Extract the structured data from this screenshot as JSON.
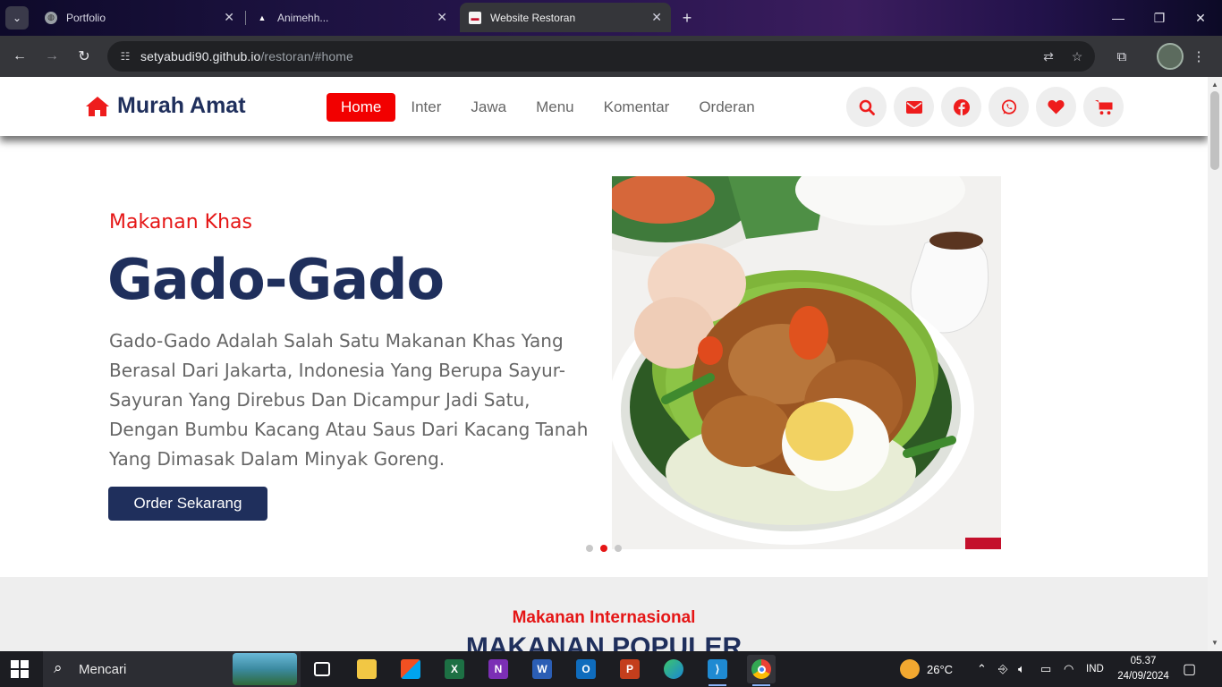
{
  "browser": {
    "tabs": [
      {
        "title": "Portfolio",
        "icon": "globe-icon",
        "active": false
      },
      {
        "title": "Animehh...",
        "icon": "triangle-icon",
        "active": false
      },
      {
        "title": "Website Restoran",
        "icon": "restaurant-favicon",
        "active": true
      }
    ],
    "url_host": "setyabudi90.github.io",
    "url_path": "/restoran/#home"
  },
  "site": {
    "brand": "Murah Amat",
    "nav": [
      {
        "label": "Home",
        "active": true
      },
      {
        "label": "Inter",
        "active": false
      },
      {
        "label": "Jawa",
        "active": false
      },
      {
        "label": "Menu",
        "active": false
      },
      {
        "label": "Komentar",
        "active": false
      },
      {
        "label": "Orderan",
        "active": false
      }
    ],
    "header_icons": [
      "search-icon",
      "envelope-icon",
      "facebook-icon",
      "whatsapp-icon",
      "heart-icon",
      "cart-icon"
    ],
    "accent": "#ee1c1c",
    "brand_color": "#1f2f5c"
  },
  "hero": {
    "subtitle": "Makanan Khas",
    "title": "Gado-Gado",
    "description": "Gado-Gado Adalah Salah Satu Makanan Khas Yang Berasal Dari Jakarta, Indonesia Yang Berupa Sayur-Sayuran Yang Direbus Dan Dicampur Jadi Satu, Dengan Bumbu Kacang Atau Saus Dari Kacang Tanah Yang Dimasak Dalam Minyak Goreng.",
    "button": "Order Sekarang",
    "slides": 3,
    "active_slide": 2
  },
  "section2": {
    "subtitle": "Makanan Internasional",
    "title": "MAKANAN POPULER"
  },
  "taskbar": {
    "search_placeholder": "Mencari",
    "weather": "26°C",
    "language": "IND",
    "time": "05.37",
    "date": "24/09/2024"
  }
}
